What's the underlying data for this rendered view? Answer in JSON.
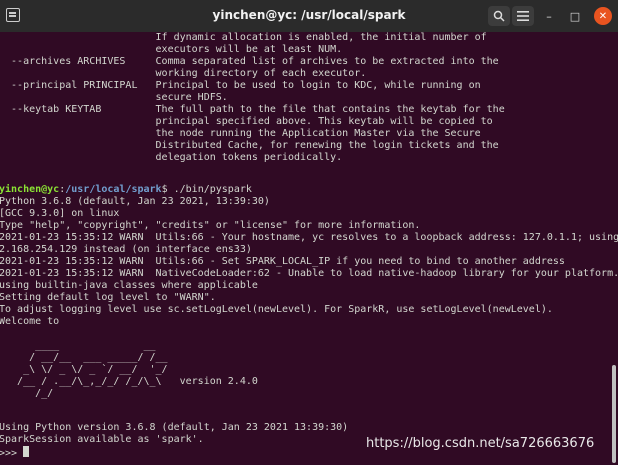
{
  "window": {
    "title": "yinchen@yc: /usr/local/spark",
    "icons": {
      "terminal": "terminal-tab-icon",
      "search": "search-icon",
      "menu": "hamburger-menu-icon",
      "minimize": "minimize-icon",
      "maximize": "maximize-icon",
      "close": "close-icon"
    },
    "close_color": "#e95420"
  },
  "terminal": {
    "background": "#300a24",
    "help_text": [
      "                          If dynamic allocation is enabled, the initial number of",
      "                          executors will be at least NUM.",
      "  --archives ARCHIVES     Comma separated list of archives to be extracted into the",
      "                          working directory of each executor.",
      "  --principal PRINCIPAL   Principal to be used to login to KDC, while running on",
      "                          secure HDFS.",
      "  --keytab KEYTAB         The full path to the file that contains the keytab for the",
      "                          principal specified above. This keytab will be copied to",
      "                          the node running the Application Master via the Secure",
      "                          Distributed Cache, for renewing the login tickets and the",
      "                          delegation tokens periodically."
    ],
    "prompt": {
      "user_host": "yinchen@yc",
      "separator": ":",
      "path": "/usr/local/spark",
      "symbol": "$ ",
      "command": "./bin/pyspark"
    },
    "output": [
      "Python 3.6.8 (default, Jan 23 2021, 13:39:30)",
      "[GCC 9.3.0] on linux",
      "Type \"help\", \"copyright\", \"credits\" or \"license\" for more information.",
      "2021-01-23 15:35:12 WARN  Utils:66 - Your hostname, yc resolves to a loopback address: 127.0.1.1; using 19",
      "2.168.254.129 instead (on interface ens33)",
      "2021-01-23 15:35:12 WARN  Utils:66 - Set SPARK_LOCAL_IP if you need to bind to another address",
      "2021-01-23 15:35:12 WARN  NativeCodeLoader:62 - Unable to load native-hadoop library for your platform...",
      "using builtin-java classes where applicable",
      "Setting default log level to \"WARN\".",
      "To adjust logging level use sc.setLogLevel(newLevel). For SparkR, use setLogLevel(newLevel).",
      "Welcome to"
    ],
    "banner": [
      "      ____              __",
      "     / __/__  ___ _____/ /__",
      "    _\\ \\/ _ \\/ _ `/ __/  '_/",
      "   /__ / .__/\\_,_/_/ /_/\\_\\   version 2.4.0",
      "      /_/"
    ],
    "footer": [
      "Using Python version 3.6.8 (default, Jan 23 2021 13:39:30)",
      "SparkSession available as 'spark'."
    ],
    "repl_prompt": ">>> "
  },
  "watermark": "https://blog.csdn.net/sa726663676"
}
